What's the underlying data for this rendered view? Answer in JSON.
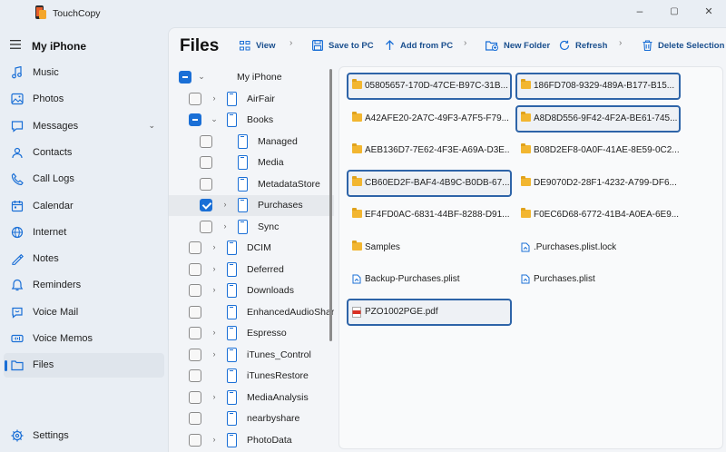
{
  "window": {
    "app_title": "TouchCopy",
    "minimize": "–",
    "maximize": "▢",
    "close": "✕"
  },
  "nav": {
    "device_name": "My iPhone",
    "items": [
      {
        "label": "Music",
        "icon": "music-icon"
      },
      {
        "label": "Photos",
        "icon": "photos-icon"
      },
      {
        "label": "Messages",
        "icon": "messages-icon",
        "expand": "⌄"
      },
      {
        "label": "Contacts",
        "icon": "contacts-icon"
      },
      {
        "label": "Call Logs",
        "icon": "call-logs-icon"
      },
      {
        "label": "Calendar",
        "icon": "calendar-icon"
      },
      {
        "label": "Internet",
        "icon": "internet-icon"
      },
      {
        "label": "Notes",
        "icon": "notes-icon"
      },
      {
        "label": "Reminders",
        "icon": "reminders-icon"
      },
      {
        "label": "Voice Mail",
        "icon": "voicemail-icon"
      },
      {
        "label": "Voice Memos",
        "icon": "voice-memos-icon"
      },
      {
        "label": "Files",
        "icon": "files-icon",
        "active": true
      }
    ],
    "settings": "Settings"
  },
  "main": {
    "title": "Files",
    "toolbar": {
      "view": "View",
      "save_to_pc": "Save to PC",
      "add_from_pc": "Add from PC",
      "new_folder": "New Folder",
      "refresh": "Refresh",
      "delete_selection": "Delete Selection",
      "separator": "›"
    }
  },
  "tree": {
    "rows": [
      {
        "label": "My iPhone",
        "state": "partial",
        "level": 0,
        "expander": "⌄",
        "icon": false
      },
      {
        "label": "AirFair",
        "state": "unchecked",
        "level": 1,
        "expander": "›",
        "icon": true
      },
      {
        "label": "Books",
        "state": "partial",
        "level": 1,
        "expander": "⌄",
        "icon": true
      },
      {
        "label": "Managed",
        "state": "unchecked",
        "level": 2,
        "expander": "",
        "icon": true
      },
      {
        "label": "Media",
        "state": "unchecked",
        "level": 2,
        "expander": "",
        "icon": true
      },
      {
        "label": "MetadataStore",
        "state": "unchecked",
        "level": 2,
        "expander": "",
        "icon": true
      },
      {
        "label": "Purchases",
        "state": "checked",
        "level": 2,
        "expander": "›",
        "icon": true,
        "selected": true
      },
      {
        "label": "Sync",
        "state": "unchecked",
        "level": 2,
        "expander": "›",
        "icon": true
      },
      {
        "label": "DCIM",
        "state": "unchecked",
        "level": 1,
        "expander": "›",
        "icon": true
      },
      {
        "label": "Deferred",
        "state": "unchecked",
        "level": 1,
        "expander": "›",
        "icon": true
      },
      {
        "label": "Downloads",
        "state": "unchecked",
        "level": 1,
        "expander": "›",
        "icon": true
      },
      {
        "label": "EnhancedAudioShare",
        "state": "unchecked",
        "level": 1,
        "expander": "",
        "icon": true
      },
      {
        "label": "Espresso",
        "state": "unchecked",
        "level": 1,
        "expander": "›",
        "icon": true
      },
      {
        "label": "iTunes_Control",
        "state": "unchecked",
        "level": 1,
        "expander": "›",
        "icon": true
      },
      {
        "label": "iTunesRestore",
        "state": "unchecked",
        "level": 1,
        "expander": "",
        "icon": true
      },
      {
        "label": "MediaAnalysis",
        "state": "unchecked",
        "level": 1,
        "expander": "›",
        "icon": true
      },
      {
        "label": "nearbyshare",
        "state": "unchecked",
        "level": 1,
        "expander": "",
        "icon": true
      },
      {
        "label": "PhotoData",
        "state": "unchecked",
        "level": 1,
        "expander": "›",
        "icon": true
      }
    ]
  },
  "files": {
    "items": [
      {
        "name": "05805657-170D-47CE-B97C-31B...",
        "type": "folder",
        "selected": true
      },
      {
        "name": "186FD708-9329-489A-B177-B15...",
        "type": "folder",
        "selected": true
      },
      {
        "name": "A42AFE20-2A7C-49F3-A7F5-F79...",
        "type": "folder",
        "selected": false
      },
      {
        "name": "A8D8D556-9F42-4F2A-BE61-745...",
        "type": "folder",
        "selected": true
      },
      {
        "name": "AEB136D7-7E62-4F3E-A69A-D3E...",
        "type": "folder",
        "selected": false
      },
      {
        "name": "B08D2EF8-0A0F-41AE-8E59-0C2...",
        "type": "folder",
        "selected": false
      },
      {
        "name": "CB60ED2F-BAF4-4B9C-B0DB-67...",
        "type": "folder",
        "selected": true
      },
      {
        "name": "DE9070D2-28F1-4232-A799-DF6...",
        "type": "folder",
        "selected": false
      },
      {
        "name": "EF4FD0AC-6831-44BF-8288-D91...",
        "type": "folder",
        "selected": false
      },
      {
        "name": "F0EC6D68-6772-41B4-A0EA-6E9...",
        "type": "folder",
        "selected": false
      },
      {
        "name": "Samples",
        "type": "folder",
        "selected": false
      },
      {
        "name": ".Purchases.plist.lock",
        "type": "plist",
        "selected": false
      },
      {
        "name": "Backup-Purchases.plist",
        "type": "plist",
        "selected": false
      },
      {
        "name": "Purchases.plist",
        "type": "plist",
        "selected": false
      },
      {
        "name": "PZO1002PGE.pdf",
        "type": "pdf",
        "selected": true
      }
    ]
  },
  "colors": {
    "accent": "#1a6fd6",
    "selection_border": "#2e64a8",
    "folder": "#f2b630",
    "pdf": "#d93025"
  }
}
